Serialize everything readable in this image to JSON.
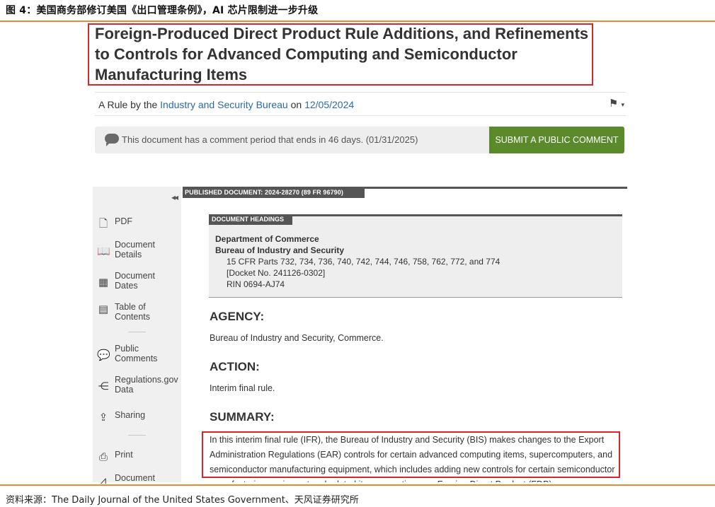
{
  "figure": {
    "caption": "图 4：美国商务部修订美国《出口管理条例》，AI 芯片限制进一步升级",
    "source": "资料来源：The Daily Journal of the United States Government、天风证券研究所"
  },
  "document": {
    "title": "Foreign-Produced Direct Product Rule Additions, and Refinements to Controls for Advanced Computing and Semiconductor Manufacturing Items",
    "byline_prefix": "A Rule by the",
    "agency_link": "Industry and Security Bureau",
    "byline_on": "on",
    "date_link": "12/05/2024",
    "flag_icon": "flag-dropdown"
  },
  "comment": {
    "notice": "This document has a comment period that ends in 46 days. (01/31/2025)",
    "button": "SUBMIT A PUBLIC COMMENT"
  },
  "sidebar": {
    "collapse": "◂◂",
    "items": [
      {
        "label": "PDF",
        "icon": "pdf-icon"
      },
      {
        "label": "Document\nDetails",
        "icon": "book-icon"
      },
      {
        "label": "Document\nDates",
        "icon": "calendar-icon"
      },
      {
        "label": "Table of\nContents",
        "icon": "toc-icon"
      },
      {
        "label": "Public\nComments",
        "icon": "comment-icon"
      },
      {
        "label": "Regulations.gov\nData",
        "icon": "share-nodes-icon"
      },
      {
        "label": "Sharing",
        "icon": "share-icon"
      },
      {
        "label": "Print",
        "icon": "print-icon"
      },
      {
        "label": "Document",
        "icon": "chart-icon"
      }
    ]
  },
  "published": "PUBLISHED DOCUMENT: 2024-28270 (89 FR 96790)",
  "headings": {
    "tag": "DOCUMENT HEADINGS",
    "line1": "Department of Commerce",
    "line2": "Bureau of Industry and Security",
    "line3": "15 CFR Parts 732, 734, 736, 740, 742, 744, 746, 758, 762, 772, and 774",
    "line4": "[Docket No. 241126-0302]",
    "line5": "RIN 0694-AJ74"
  },
  "agency": {
    "title": "AGENCY:",
    "text": "Bureau of Industry and Security, Commerce."
  },
  "action": {
    "title": "ACTION:",
    "text": "Interim final rule."
  },
  "summary": {
    "title": "SUMMARY:",
    "text": "In this interim final rule (IFR), the Bureau of Industry and Security (BIS) makes changes to the Export Administration Regulations (EAR) controls for certain advanced computing items, supercomputers, and semiconductor manufacturing equipment, which includes adding new controls for certain semiconductor manufacturing equipment and related items, creating new Foreign Direct Product (FDP)"
  },
  "colors": {
    "accent": "#e88a2e",
    "highlight": "#d8262c",
    "button": "#5a8a2a",
    "link": "#2c6aa6"
  }
}
